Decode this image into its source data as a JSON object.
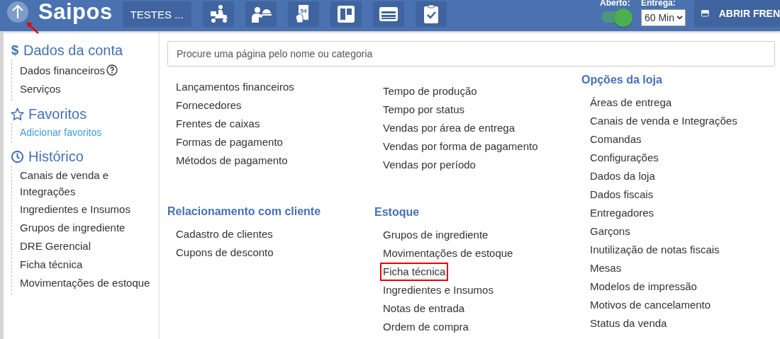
{
  "topbar": {
    "logo": "Saipos",
    "store_button": "TESTES ...",
    "toolbar": [
      {
        "kind": "delivery"
      },
      {
        "kind": "waiter"
      },
      {
        "kind": "receipt",
        "text": "54"
      },
      {
        "kind": "board"
      },
      {
        "kind": "panel"
      },
      {
        "kind": "checklist"
      }
    ],
    "open_toggle": {
      "label": "Aberto:",
      "on": true
    },
    "delivery_select": {
      "label": "Entrega:",
      "value": "60 Min"
    },
    "front_button": "ABRIR FREN"
  },
  "sidebar": {
    "sections": [
      {
        "symbol": "$",
        "title": "Dados da conta",
        "items": [
          {
            "label": "Dados financeiros",
            "help": true,
            "kind": "item"
          },
          {
            "label": "Serviços",
            "kind": "item"
          }
        ]
      },
      {
        "title": "Favoritos",
        "items": [
          {
            "label": "Adicionar favoritos",
            "kind": "link"
          }
        ]
      },
      {
        "title": "Histórico",
        "items": [
          {
            "label": "Canais de venda e Integrações",
            "kind": "item"
          },
          {
            "label": "Ingredientes e Insumos",
            "kind": "item"
          },
          {
            "label": "Grupos de ingrediente",
            "kind": "item"
          },
          {
            "label": "DRE Gerencial",
            "kind": "item"
          },
          {
            "label": "Ficha técnica",
            "kind": "item"
          },
          {
            "label": "Movimentações de estoque",
            "kind": "item"
          }
        ]
      }
    ]
  },
  "search": {
    "placeholder": "Procure uma página pelo nome ou categoria"
  },
  "columns": [
    [
      {
        "items": [
          {
            "label": "Lançamentos financeiros",
            "highlighted": false
          },
          {
            "label": "Fornecedores",
            "highlighted": false
          },
          {
            "label": "Frentes de caixas",
            "highlighted": false
          },
          {
            "label": "Formas de pagamento",
            "highlighted": false
          },
          {
            "label": "Métodos de pagamento",
            "highlighted": false
          }
        ]
      },
      {
        "title": "Relacionamento com cliente",
        "items": [
          {
            "label": "Cadastro de clientes",
            "highlighted": false
          },
          {
            "label": "Cupons de desconto",
            "highlighted": false
          }
        ]
      }
    ],
    [
      {
        "items": [
          {
            "label": "Tempo de produção",
            "highlighted": false
          },
          {
            "label": "Tempo por status",
            "highlighted": false
          },
          {
            "label": "Vendas por área de entrega",
            "highlighted": false
          },
          {
            "label": "Vendas por forma de pagamento",
            "highlighted": false
          },
          {
            "label": "Vendas por período",
            "highlighted": false
          }
        ]
      },
      {
        "title": "Estoque",
        "items": [
          {
            "label": "Grupos de ingrediente",
            "highlighted": false
          },
          {
            "label": "Movimentações de estoque",
            "highlighted": false
          },
          {
            "label": "Ficha técnica",
            "highlighted": true
          },
          {
            "label": "Ingredientes e Insumos",
            "highlighted": false
          },
          {
            "label": "Notas de entrada",
            "highlighted": false
          },
          {
            "label": "Ordem de compra",
            "highlighted": false
          }
        ]
      }
    ],
    [
      {
        "title": "Opções da loja",
        "items": [
          {
            "label": "Áreas de entrega",
            "highlighted": false
          },
          {
            "label": "Canais de venda e Integrações",
            "highlighted": false
          },
          {
            "label": "Comandas",
            "highlighted": false
          },
          {
            "label": "Configurações",
            "highlighted": false
          },
          {
            "label": "Dados da loja",
            "highlighted": false
          },
          {
            "label": "Dados fiscais",
            "highlighted": false
          },
          {
            "label": "Entregadores",
            "highlighted": false
          },
          {
            "label": "Garçons",
            "highlighted": false
          },
          {
            "label": "Inutilização de notas fiscais",
            "highlighted": false
          },
          {
            "label": "Mesas",
            "highlighted": false
          },
          {
            "label": "Modelos de impressão",
            "highlighted": false
          },
          {
            "label": "Motivos de cancelamento",
            "highlighted": false
          },
          {
            "label": "Status da venda",
            "highlighted": false
          }
        ]
      }
    ]
  ]
}
